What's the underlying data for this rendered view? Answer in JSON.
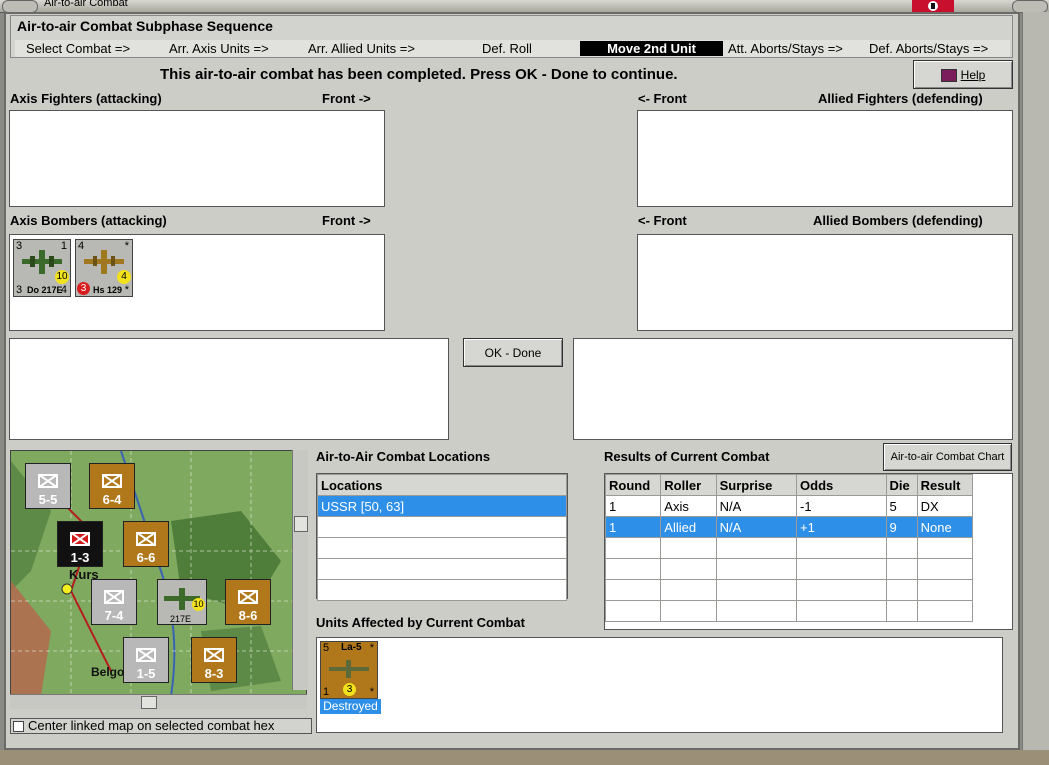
{
  "window": {
    "title": "Air-to-air Combat"
  },
  "sequence": {
    "title": "Air-to-air Combat Subphase Sequence",
    "steps": [
      {
        "label": "Select Combat =>"
      },
      {
        "label": "Arr. Axis Units =>"
      },
      {
        "label": "Arr. Allied Units =>"
      },
      {
        "label": "Def. Roll"
      },
      {
        "label": "Move 2nd Unit"
      },
      {
        "label": "Att. Aborts/Stays =>"
      },
      {
        "label": "Def. Aborts/Stays =>"
      }
    ],
    "active_step": "Move 2nd Unit"
  },
  "status_message": "This air-to-air combat has been completed.  Press OK - Done to continue.",
  "help_button": "Help",
  "axis_fighters": {
    "label": "Axis Fighters (attacking)",
    "front": "Front ->"
  },
  "allied_fighters": {
    "label": "Allied Fighters (defending)",
    "front": "<- Front"
  },
  "axis_bombers": {
    "label": "Axis Bombers (attacking)",
    "front": "Front ->",
    "units": [
      {
        "name": "Do 217E",
        "tl": "3",
        "tr": "1",
        "bl": "3",
        "br": "4",
        "badge": "10",
        "badge_color": "#f2e21b",
        "body_color": "#b8b8b4",
        "plane_color": "#3c6a2a"
      },
      {
        "name": "Hs 129",
        "tl": "4",
        "tr": "*",
        "bl": "3",
        "br": "*",
        "badge": "4",
        "badge_color": "#f2e21b",
        "body_color": "#b8b8b4",
        "plane_color": "#a0781e",
        "red_badge": "3"
      }
    ]
  },
  "allied_bombers": {
    "label": "Allied Bombers (defending)",
    "front": "<- Front"
  },
  "ok_button": "OK - Done",
  "locations": {
    "title": "Air-to-Air Combat Locations",
    "header": "Locations",
    "rows": [
      "USSR [50, 63]",
      "",
      "",
      "",
      "",
      ""
    ]
  },
  "results": {
    "title": "Results of Current Combat",
    "chart_button": "Air-to-air Combat Chart",
    "columns": [
      "Round",
      "Roller",
      "Surprise",
      "Odds",
      "Die",
      "Result"
    ],
    "rows": [
      [
        "1",
        "Axis",
        "N/A",
        "-1",
        "5",
        "DX"
      ],
      [
        "1",
        "Allied",
        "N/A",
        "+1",
        "9",
        "None"
      ],
      [
        "",
        "",
        "",
        "",
        "",
        ""
      ],
      [
        "",
        "",
        "",
        "",
        "",
        ""
      ],
      [
        "",
        "",
        "",
        "",
        "",
        ""
      ],
      [
        "",
        "",
        "",
        "",
        "",
        ""
      ]
    ]
  },
  "affected": {
    "title": "Units Affected by Current Combat",
    "units": [
      {
        "name": "La-5",
        "tl": "5",
        "tr": "*",
        "bl": "1",
        "br": "*",
        "badge": "3",
        "status": "Destroyed"
      }
    ]
  },
  "map": {
    "city_label": "Kurs",
    "city2_label": "Belgo",
    "counters": [
      {
        "id": "c1",
        "value": "5-5",
        "top": "xxx",
        "color": "#b8b8b8"
      },
      {
        "id": "c2",
        "value": "6-4",
        "top": "xxxx",
        "color": "#b0781a"
      },
      {
        "id": "c3",
        "value": "1-3",
        "top": "xx",
        "color": "#111111"
      },
      {
        "id": "c4",
        "value": "6-6",
        "top": "xxxx",
        "color": "#b0781a"
      },
      {
        "id": "c5",
        "value": "7-4",
        "top": "xxx",
        "color": "#b8b8b8"
      },
      {
        "id": "c6",
        "value": "8-6",
        "top": "xxxx",
        "color": "#b0781a"
      },
      {
        "id": "c7",
        "value": "1-5",
        "top": "xx",
        "color": "#b8b8b8"
      },
      {
        "id": "c8",
        "value": "8-3",
        "top": "xxxx",
        "color": "#b0781a"
      }
    ],
    "plane_badge": "10",
    "plane_label": "217E"
  },
  "center_checkbox": "Center linked map on selected combat hex"
}
